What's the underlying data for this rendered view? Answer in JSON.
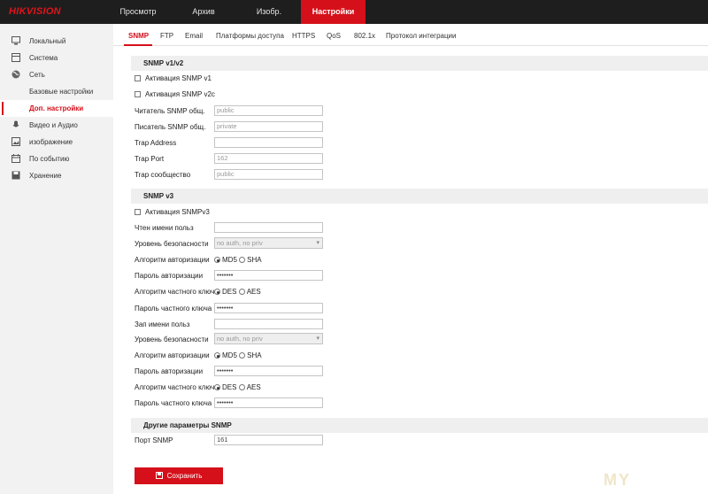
{
  "brand": {
    "logo_text": "HIKVISION",
    "accent_color": "#d5101a"
  },
  "top_nav": [
    {
      "label": "Просмотр",
      "active": false
    },
    {
      "label": "Архив",
      "active": false
    },
    {
      "label": "Изобр.",
      "active": false
    },
    {
      "label": "Настройки",
      "active": true
    }
  ],
  "sidebar": {
    "items": [
      {
        "label": "Локальный",
        "icon": "monitor-icon"
      },
      {
        "label": "Система",
        "icon": "system-icon"
      },
      {
        "label": "Сеть",
        "icon": "globe-icon"
      },
      {
        "label": "Видео и Аудио",
        "icon": "mic-icon"
      },
      {
        "label": "изображение",
        "icon": "image-icon"
      },
      {
        "label": "По событию",
        "icon": "calendar-icon"
      },
      {
        "label": "Хранение",
        "icon": "disk-icon"
      }
    ],
    "sub_items": [
      {
        "label": "Базовые настройки",
        "active": false
      },
      {
        "label": "Доп. настройки",
        "active": true
      }
    ]
  },
  "sub_tabs": [
    {
      "label": "SNMP",
      "active": true
    },
    {
      "label": "FTP",
      "active": false
    },
    {
      "label": "Email",
      "active": false
    },
    {
      "label": "Платформы доступа",
      "active": false
    },
    {
      "label": "HTTPS",
      "active": false
    },
    {
      "label": "QoS",
      "active": false
    },
    {
      "label": "802.1x",
      "active": false
    },
    {
      "label": "Протокол интеграции",
      "active": false
    }
  ],
  "snmp_v1v2": {
    "header": "SNMP v1/v2",
    "enable_v1_label": "Активация SNMP v1",
    "enable_v2c_label": "Активация SNMP v2c",
    "read_community_label": "Читатель SNMP общ.",
    "read_community_value": "public",
    "write_community_label": "Писатель SNMP общ.",
    "write_community_value": "private",
    "trap_address_label": "Trap Address",
    "trap_address_value": "",
    "trap_port_label": "Trap Port",
    "trap_port_value": "162",
    "trap_community_label": "Trap сообщество",
    "trap_community_value": "public"
  },
  "snmp_v3": {
    "header": "SNMP v3",
    "enable_v3_label": "Активация SNMPv3",
    "read_user_label": "Чтен имени польз",
    "read_user_value": "",
    "read_security_label": "Уровень безопасности",
    "read_security_value": "no auth, no priv",
    "read_auth_algo_label": "Алгоритм авторизации",
    "read_auth_algo_opt1": "MD5",
    "read_auth_algo_opt2": "SHA",
    "read_auth_pass_label": "Пароль авторизации",
    "read_auth_pass_value": "•••••••",
    "read_priv_algo_label": "Алгоритм частного ключа",
    "read_priv_algo_opt1": "DES",
    "read_priv_algo_opt2": "AES",
    "read_priv_pass_label": "Пароль частного ключа",
    "read_priv_pass_value": "•••••••",
    "write_user_label": "Зап имени польз",
    "write_user_value": "",
    "write_security_label": "Уровень безопасности",
    "write_security_value": "no auth, no priv",
    "write_auth_algo_label": "Алгоритм авторизации",
    "write_auth_algo_opt1": "MD5",
    "write_auth_algo_opt2": "SHA",
    "write_auth_pass_label": "Пароль авторизации",
    "write_auth_pass_value": "•••••••",
    "write_priv_algo_label": "Алгоритм частного ключа",
    "write_priv_algo_opt1": "DES",
    "write_priv_algo_opt2": "AES",
    "write_priv_pass_label": "Пароль частного ключа",
    "write_priv_pass_value": "•••••••"
  },
  "snmp_other": {
    "header": "Другие параметры SNMP",
    "port_label": "Порт SNMP",
    "port_value": "161"
  },
  "save_label": "Сохранить",
  "watermark": "MY"
}
